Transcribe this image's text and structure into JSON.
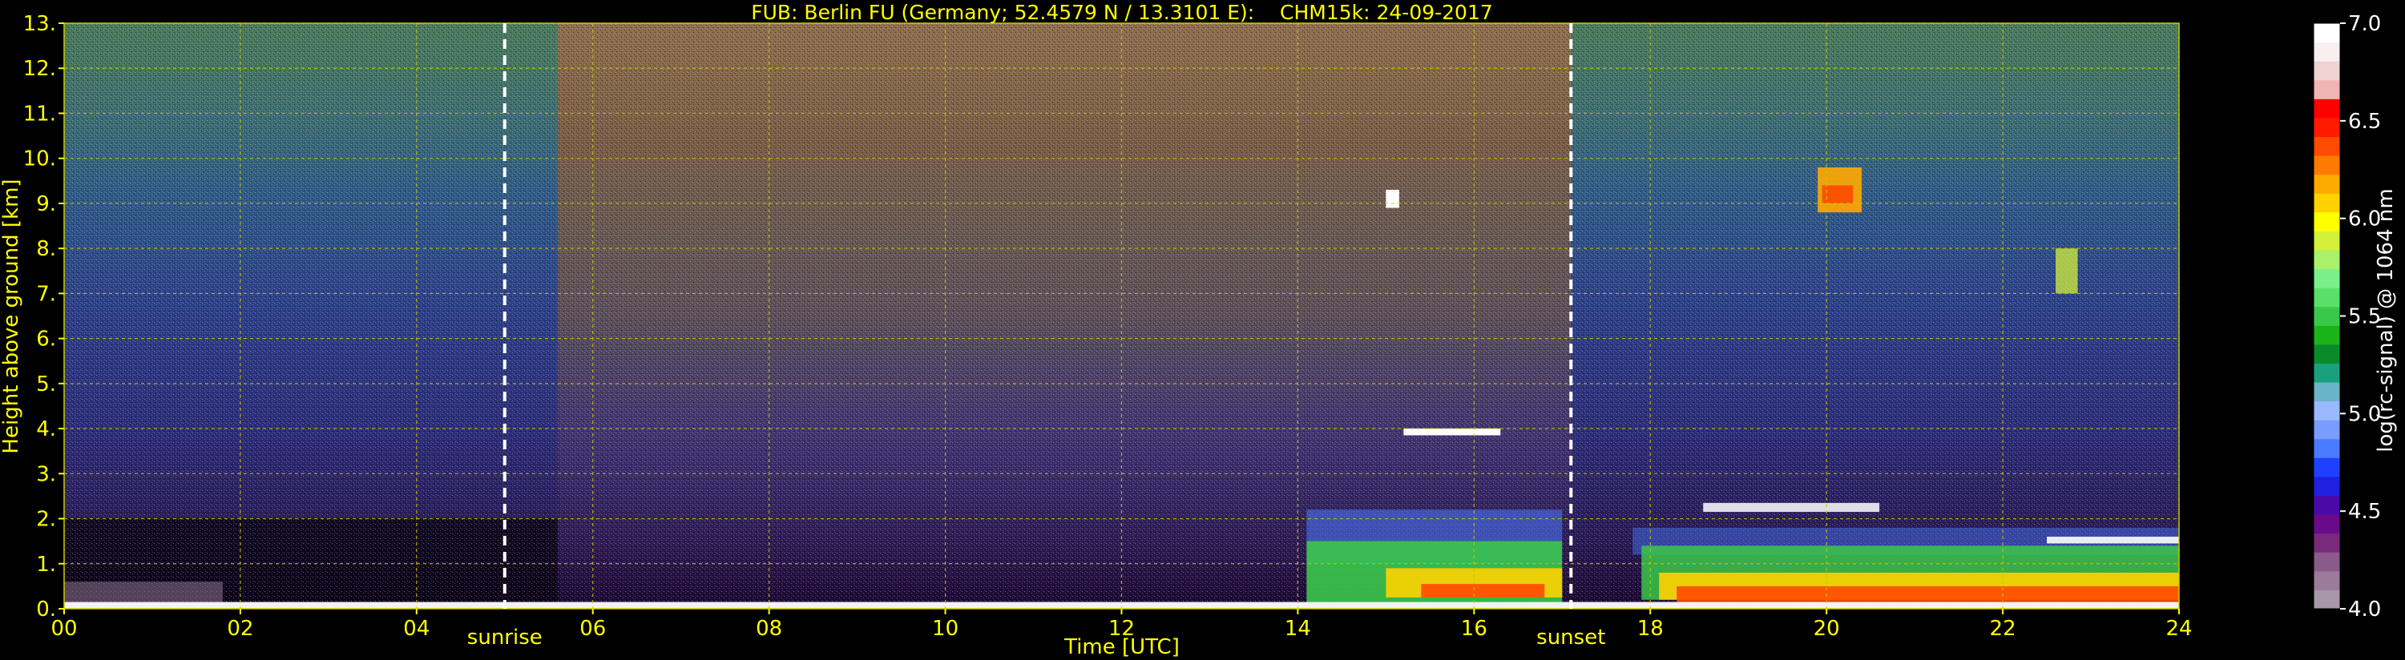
{
  "chart_data": {
    "type": "heatmap",
    "title": "FUB: Berlin FU (Germany; 52.4579 N / 13.3101 E):    CHM15k: 24-09-2017",
    "xlabel": "Time [UTC]",
    "ylabel": "Height above ground [km]",
    "xlim": [
      0,
      24
    ],
    "ylim": [
      0,
      13
    ],
    "x_ticks": [
      0,
      2,
      4,
      6,
      8,
      10,
      12,
      14,
      16,
      18,
      20,
      22,
      24
    ],
    "x_tick_labels": [
      "00",
      "02",
      "04",
      "06",
      "08",
      "10",
      "12",
      "14",
      "16",
      "18",
      "20",
      "22",
      "24"
    ],
    "y_ticks": [
      0,
      1,
      2,
      3,
      4,
      5,
      6,
      7,
      8,
      9,
      10,
      11,
      12,
      13
    ],
    "y_tick_labels": [
      "0.",
      "1.",
      "2.",
      "3.",
      "4.",
      "5.",
      "6.",
      "7.",
      "8.",
      "9.",
      "10.",
      "11.",
      "12.",
      "13."
    ],
    "grid": true,
    "events": [
      {
        "label": "sunrise",
        "x": 5.0
      },
      {
        "label": "sunset",
        "x": 17.1
      }
    ],
    "colorbar": {
      "label": "log(rc-signal) @ 1064 nm",
      "range": [
        4.0,
        7.0
      ],
      "ticks": [
        4.0,
        4.5,
        5.0,
        5.5,
        6.0,
        6.5,
        7.0
      ],
      "tick_labels": [
        "4.0",
        "4.5",
        "5.0",
        "5.5",
        "6.0",
        "6.5",
        "7.0"
      ],
      "colors": [
        "#a897a8",
        "#9a7c9a",
        "#8a5a8a",
        "#7a2a7a",
        "#6a0a8a",
        "#4a0aaa",
        "#2020e0",
        "#2040ff",
        "#4a7aff",
        "#7a9cff",
        "#9ab8ff",
        "#6ab4c8",
        "#1aa07a",
        "#0a8a2a",
        "#1ab41a",
        "#3ac84a",
        "#5ae06a",
        "#7af08a",
        "#aaf06a",
        "#d4f03a",
        "#ffff00",
        "#ffd200",
        "#ffaa00",
        "#ff7a00",
        "#ff4a00",
        "#ff1a00",
        "#ff0000",
        "#f0b4b4",
        "#f0d2d2",
        "#f8f0f0",
        "#ffffff"
      ]
    },
    "features": [
      {
        "name": "surface-aerosol-layer",
        "x_start": 0,
        "x_end": 24,
        "height_top": 0.15
      },
      {
        "name": "boundary-layer",
        "x_start": 14.1,
        "x_end": 17.0,
        "height_top": 1.8
      },
      {
        "name": "boundary-layer",
        "x_start": 17.2,
        "x_end": 24,
        "height_top": 1.5
      },
      {
        "name": "cloud",
        "x_start": 15.2,
        "x_end": 16.3,
        "height": 3.9
      },
      {
        "name": "cirrus",
        "x_start": 19.9,
        "x_end": 20.4,
        "height": 9.2
      },
      {
        "name": "cirrus",
        "x_start": 22.6,
        "x_end": 22.85,
        "height": 7.5
      },
      {
        "name": "cloud",
        "x_start": 15.0,
        "x_end": 15.15,
        "height": 9.1
      }
    ]
  }
}
